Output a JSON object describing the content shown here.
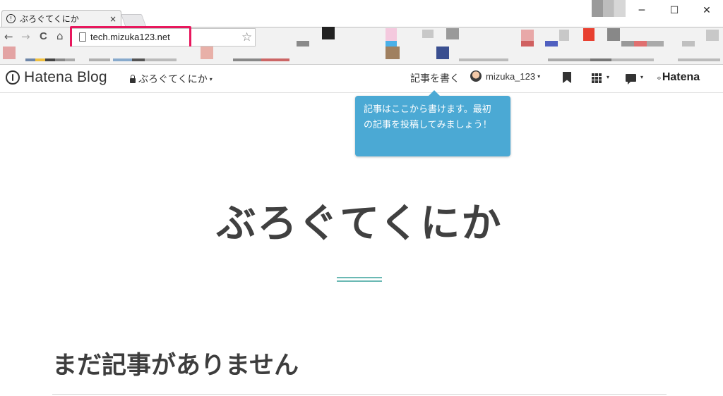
{
  "browser": {
    "tab_title": "ぶろぐてくにか",
    "tab_close": "×",
    "url": "tech.mizuka123.net",
    "window_controls": {
      "minimize": "─",
      "maximize": "☐",
      "close": "✕"
    },
    "nav": {
      "back": "←",
      "forward": "→",
      "reload": "C",
      "home": "⌂",
      "star": "☆"
    },
    "favicon_glyph": "!",
    "highlight_color": "#e8175d"
  },
  "hatena_bar": {
    "logo_text": "Hatena Blog",
    "blog_name": "ぶろぐてくにか",
    "write_label": "記事を書く",
    "username": "mizuka_123",
    "caret": "▾",
    "brand_text": "Hatena",
    "brand_mark": "‹›",
    "icons": [
      "bookmark-icon",
      "apps-grid-icon",
      "comment-icon"
    ]
  },
  "tooltip": {
    "line1": "記事はここから書けます。最初",
    "line2": "の記事を投稿してみましょう！",
    "color": "#4ba9d4"
  },
  "page": {
    "blog_title": "ぶろぐてくにか",
    "empty_message": "まだ記事がありません",
    "accent_color": "#6bb9b4"
  }
}
